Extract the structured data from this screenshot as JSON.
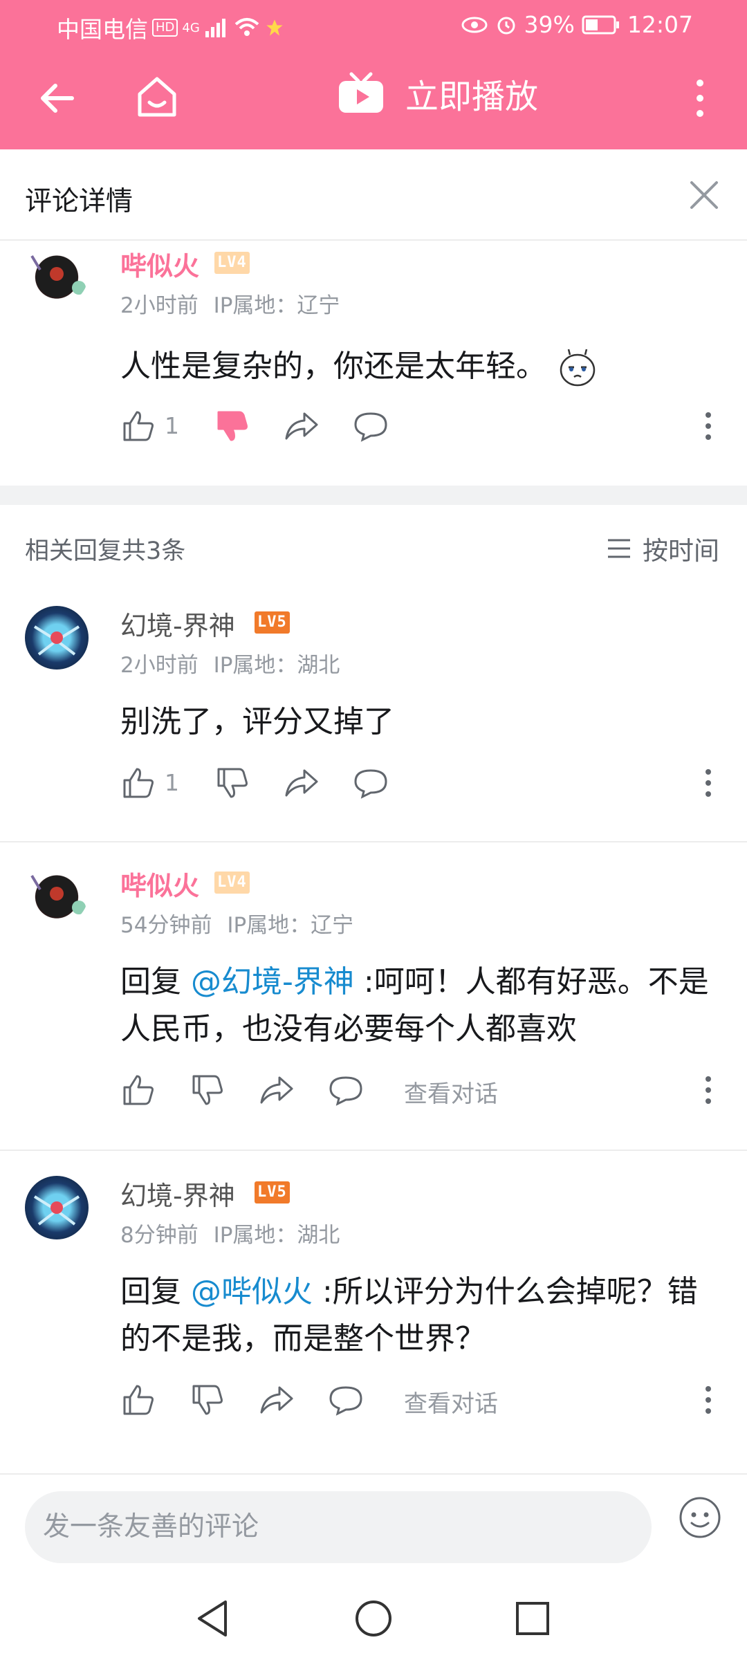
{
  "status": {
    "carrier": "中国电信",
    "hd": "HD",
    "network": "4G",
    "battery": "39%",
    "time": "12:07"
  },
  "appbar": {
    "play_label": "立即播放"
  },
  "detail": {
    "title": "评论详情"
  },
  "main_comment": {
    "user": "哔似火",
    "level": "LV4",
    "time": "2小时前",
    "ip": "IP属地：辽宁",
    "text": "人性是复杂的，你还是太年轻。",
    "likes": "1"
  },
  "replies_header": {
    "count": "相关回复共3条",
    "sort": "按时间"
  },
  "replies": [
    {
      "user": "幻境-界神",
      "level": "LV5",
      "time": "2小时前",
      "ip": "IP属地：湖北",
      "text": "别洗了，评分又掉了",
      "likes": "1"
    },
    {
      "user": "哔似火",
      "level": "LV4",
      "time": "54分钟前",
      "ip": "IP属地：辽宁",
      "reply_prefix": "回复 ",
      "mention": "@幻境-界神",
      "text": " :呵呵！人都有好恶。不是人民币，也没有必要每个人都喜欢",
      "view_conversation": "查看对话"
    },
    {
      "user": "幻境-界神",
      "level": "LV5",
      "time": "8分钟前",
      "ip": "IP属地：湖北",
      "reply_prefix": "回复 ",
      "mention": "@哔似火",
      "text": " :所以评分为什么会掉呢？错的不是我，而是整个世界？",
      "view_conversation": "查看对话"
    }
  ],
  "input": {
    "placeholder": "发一条友善的评论"
  },
  "colors": {
    "brand": "#fb7299",
    "mention": "#178bcf",
    "lv4": "#ffd8a8",
    "lv5": "#f17a2a"
  }
}
